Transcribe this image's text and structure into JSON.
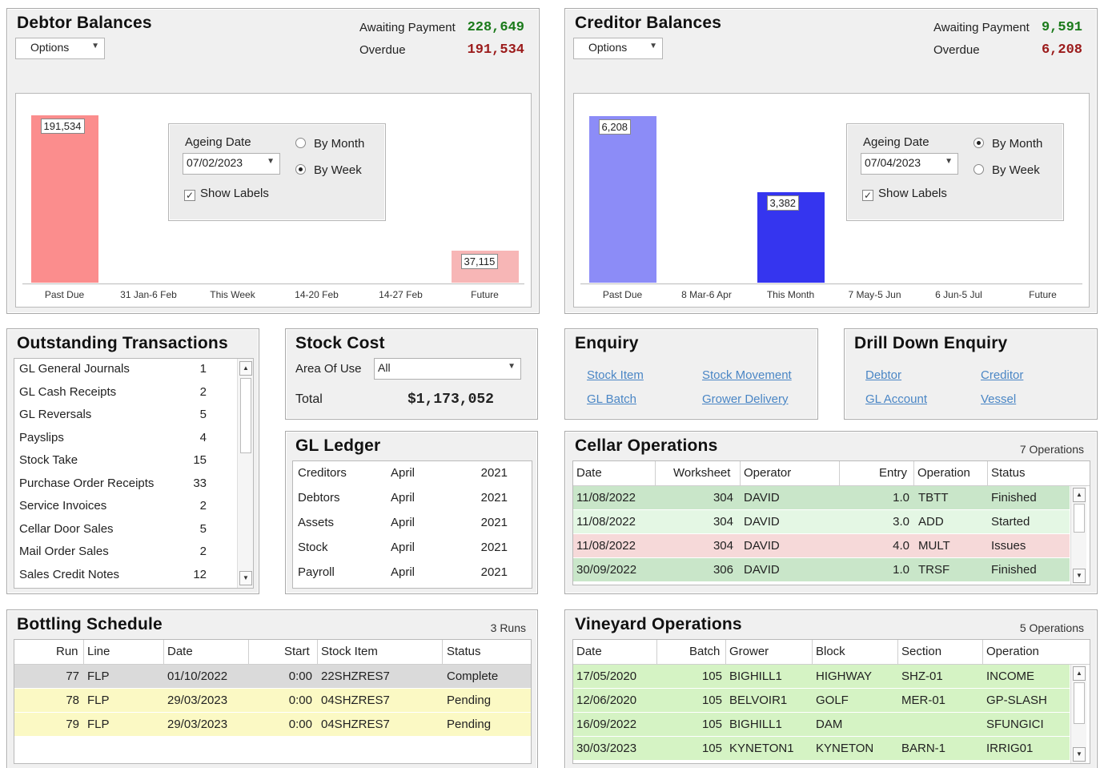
{
  "debtor": {
    "title": "Debtor Balances",
    "options": "Options",
    "awaiting_label": "Awaiting Payment",
    "awaiting_value": "228,649",
    "overdue_label": "Overdue",
    "overdue_value": "191,534",
    "ageing_label": "Ageing Date",
    "ageing_date": "07/02/2023",
    "by_month": "By Month",
    "by_week": "By Week",
    "by_week_selected": true,
    "show_labels": "Show Labels",
    "chart_data": {
      "type": "bar",
      "categories": [
        "Past Due",
        "31 Jan-6 Feb",
        "This Week",
        "14-20 Feb",
        "14-27 Feb",
        "Future"
      ],
      "values": [
        191534,
        0,
        0,
        0,
        0,
        37115
      ],
      "labels": [
        "191,534",
        "",
        "",
        "",
        "",
        "37,115"
      ],
      "colors": [
        "#fb8d8d",
        "",
        "",
        "",
        "",
        "#f7b6b6"
      ],
      "ylim": [
        0,
        200000
      ]
    }
  },
  "creditor": {
    "title": "Creditor Balances",
    "options": "Options",
    "awaiting_label": "Awaiting Payment",
    "awaiting_value": "9,591",
    "overdue_label": "Overdue",
    "overdue_value": "6,208",
    "ageing_label": "Ageing Date",
    "ageing_date": "07/04/2023",
    "by_month": "By Month",
    "by_week": "By Week",
    "by_week_selected": false,
    "show_labels": "Show Labels",
    "chart_data": {
      "type": "bar",
      "categories": [
        "Past Due",
        "8 Mar-6 Apr",
        "This Month",
        "7 May-5 Jun",
        "6 Jun-5 Jul",
        "Future"
      ],
      "values": [
        6208,
        0,
        3382,
        0,
        0,
        0
      ],
      "labels": [
        "6,208",
        "",
        "3,382",
        "",
        "",
        ""
      ],
      "colors": [
        "#8c8cf7",
        "",
        "#3535ef",
        "",
        "",
        ""
      ],
      "ylim": [
        0,
        6500
      ]
    }
  },
  "outstanding": {
    "title": "Outstanding Transactions",
    "items": [
      {
        "label": "GL General Journals",
        "count": "1"
      },
      {
        "label": "GL Cash Receipts",
        "count": "2"
      },
      {
        "label": "GL Reversals",
        "count": "5"
      },
      {
        "label": "Payslips",
        "count": "4"
      },
      {
        "label": "Stock Take",
        "count": "15"
      },
      {
        "label": "Purchase Order Receipts",
        "count": "33"
      },
      {
        "label": "Service Invoices",
        "count": "2"
      },
      {
        "label": "Cellar Door Sales",
        "count": "5"
      },
      {
        "label": "Mail Order Sales",
        "count": "2"
      },
      {
        "label": "Sales Credit Notes",
        "count": "12"
      }
    ]
  },
  "stock_cost": {
    "title": "Stock Cost",
    "area_label": "Area Of Use",
    "area_value": "All",
    "total_label": "Total",
    "total_value": "$1,173,052"
  },
  "gl_ledger": {
    "title": "GL Ledger",
    "rows": [
      {
        "name": "Creditors",
        "month": "April",
        "year": "2021"
      },
      {
        "name": "Debtors",
        "month": "April",
        "year": "2021"
      },
      {
        "name": "Assets",
        "month": "April",
        "year": "2021"
      },
      {
        "name": "Stock",
        "month": "April",
        "year": "2021"
      },
      {
        "name": "Payroll",
        "month": "April",
        "year": "2021"
      }
    ]
  },
  "enquiry": {
    "title": "Enquiry",
    "links": [
      "Stock Item",
      "Stock Movement",
      "GL Batch",
      "Grower Delivery"
    ]
  },
  "drill": {
    "title": "Drill Down Enquiry",
    "links": [
      "Debtor",
      "Creditor",
      "GL Account",
      "Vessel"
    ]
  },
  "cellar": {
    "title": "Cellar Operations",
    "count": "7 Operations",
    "headers": [
      "Date",
      "Worksheet",
      "Operator",
      "Entry",
      "Operation",
      "Status"
    ],
    "rows": [
      {
        "date": "11/08/2022",
        "ws": "304",
        "op": "DAVID",
        "entry": "1.0",
        "oper": "TBTT",
        "status": "Finished",
        "color": "#c9e6c9"
      },
      {
        "date": "11/08/2022",
        "ws": "304",
        "op": "DAVID",
        "entry": "3.0",
        "oper": "ADD",
        "status": "Started",
        "color": "#e4f7e4"
      },
      {
        "date": "11/08/2022",
        "ws": "304",
        "op": "DAVID",
        "entry": "4.0",
        "oper": "MULT",
        "status": "Issues",
        "color": "#f6d9d9"
      },
      {
        "date": "30/09/2022",
        "ws": "306",
        "op": "DAVID",
        "entry": "1.0",
        "oper": "TRSF",
        "status": "Finished",
        "color": "#c9e6c9"
      }
    ]
  },
  "bottling": {
    "title": "Bottling Schedule",
    "count": "3 Runs",
    "headers": [
      "Run",
      "Line",
      "Date",
      "Start",
      "Stock Item",
      "Status"
    ],
    "rows": [
      {
        "run": "77",
        "line": "FLP",
        "date": "01/10/2022",
        "start": "0:00",
        "item": "22SHZRES7",
        "status": "Complete",
        "color": "#dadada"
      },
      {
        "run": "78",
        "line": "FLP",
        "date": "29/03/2023",
        "start": "0:00",
        "item": "04SHZRES7",
        "status": "Pending",
        "color": "#fbf9c4"
      },
      {
        "run": "79",
        "line": "FLP",
        "date": "29/03/2023",
        "start": "0:00",
        "item": "04SHZRES7",
        "status": "Pending",
        "color": "#fbf9c4"
      }
    ]
  },
  "vineyard": {
    "title": "Vineyard Operations",
    "count": "5 Operations",
    "headers": [
      "Date",
      "Batch",
      "Grower",
      "Block",
      "Section",
      "Operation"
    ],
    "rows": [
      {
        "date": "17/05/2020",
        "batch": "105",
        "grower": "BIGHILL1",
        "block": "HIGHWAY",
        "section": "SHZ-01",
        "oper": "INCOME"
      },
      {
        "date": "12/06/2020",
        "batch": "105",
        "grower": "BELVOIR1",
        "block": "GOLF",
        "section": "MER-01",
        "oper": "GP-SLASH"
      },
      {
        "date": "16/09/2022",
        "batch": "105",
        "grower": "BIGHILL1",
        "block": "DAM",
        "section": "",
        "oper": "SFUNGICI"
      },
      {
        "date": "30/03/2023",
        "batch": "105",
        "grower": "KYNETON1",
        "block": "KYNETON",
        "section": "BARN-1",
        "oper": "IRRIG01"
      }
    ],
    "row_color": "#d5f3c4"
  }
}
